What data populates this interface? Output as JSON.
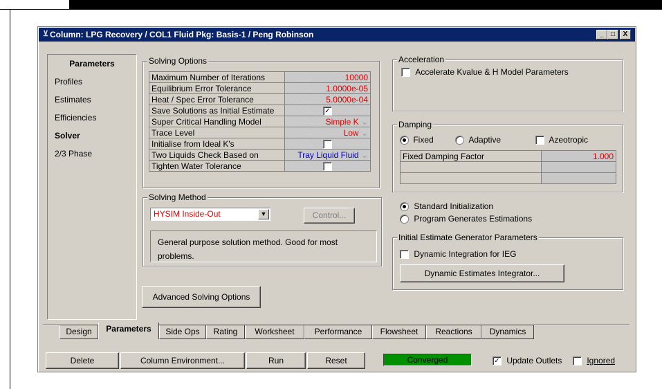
{
  "window": {
    "title": "Column: LPG Recovery / COL1  Fluid Pkg: Basis-1 / Peng Robinson",
    "buttons": [
      "_",
      "□",
      "X"
    ]
  },
  "nav": {
    "heading": "Parameters",
    "items": [
      "Profiles",
      "Estimates",
      "Efficiencies",
      "Solver",
      "2/3 Phase"
    ],
    "selected": "Solver"
  },
  "solving_options": {
    "label": "Solving Options",
    "rows": [
      {
        "label": "Maximum Number of Iterations",
        "value": "10000"
      },
      {
        "label": "Equilibrium Error Tolerance",
        "value": "1.0000e-05"
      },
      {
        "label": "Heat / Spec Error Tolerance",
        "value": "5.0000e-04"
      },
      {
        "label": "Save Solutions as Initial Estimate",
        "value": "checked"
      },
      {
        "label": "Super Critical Handling Model",
        "value": "Simple K"
      },
      {
        "label": "Trace Level",
        "value": "Low"
      },
      {
        "label": "Initialise from Ideal K's",
        "value": "unchecked"
      },
      {
        "label": "Two Liquids Check Based on",
        "value": "Tray Liquid Fluid"
      },
      {
        "label": "Tighten Water Tolerance",
        "value": "unchecked"
      }
    ]
  },
  "solving_method": {
    "label": "Solving Method",
    "selected": "HYSIM Inside-Out",
    "control_button": "Control...",
    "description": "General purpose solution method. Good for most problems."
  },
  "advanced_button": "Advanced Solving Options",
  "acceleration": {
    "label": "Acceleration",
    "checkbox_label": "Accelerate Kvalue & H Model Parameters",
    "checked": false
  },
  "damping": {
    "label": "Damping",
    "options": [
      "Fixed",
      "Adaptive"
    ],
    "selected": "Fixed",
    "azeotropic_label": "Azeotropic",
    "azeotropic_checked": false,
    "factor_label": "Fixed Damping Factor",
    "factor_value": "1.000"
  },
  "initialization": {
    "options": [
      "Standard Initialization",
      "Program Generates Estimations"
    ],
    "selected": "Standard Initialization"
  },
  "ieg": {
    "label": "Initial Estimate Generator Parameters",
    "checkbox_label": "Dynamic Integration for IEG",
    "checked": false,
    "button": "Dynamic Estimates Integrator..."
  },
  "tabs": {
    "items": [
      "Design",
      "Parameters",
      "Side Ops",
      "Rating",
      "Worksheet",
      "Performance",
      "Flowsheet",
      "Reactions",
      "Dynamics"
    ],
    "active": "Parameters"
  },
  "footer": {
    "delete": "Delete",
    "column_env": "Column Environment...",
    "run": "Run",
    "reset": "Reset",
    "status": "Converged",
    "status_color": "#009000",
    "update_outlets_label": "Update Outlets",
    "update_outlets_checked": true,
    "ignored_label": "Ignored",
    "ignored_checked": false
  }
}
